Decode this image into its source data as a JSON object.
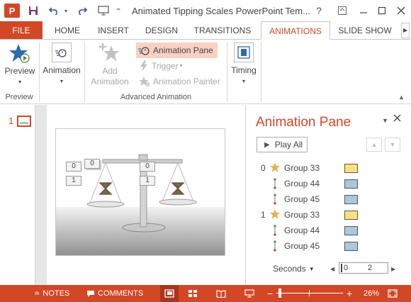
{
  "app": {
    "logo_letter": "P",
    "title": "Animated Tipping Scales PowerPoint Tem...",
    "help_glyph": "?",
    "colors": {
      "accent": "#d24726",
      "highlight": "#f8d1c3"
    }
  },
  "qat": {
    "save_icon": "save-icon",
    "undo_icon": "undo-icon",
    "redo_icon": "redo-icon",
    "present_icon": "start-presentation-icon"
  },
  "tabs": [
    {
      "label": "FILE"
    },
    {
      "label": "HOME"
    },
    {
      "label": "INSERT"
    },
    {
      "label": "DESIGN"
    },
    {
      "label": "TRANSITIONS"
    },
    {
      "label": "ANIMATIONS",
      "active": true
    },
    {
      "label": "SLIDE SHOW"
    }
  ],
  "ribbon": {
    "preview": {
      "label": "Preview",
      "group": "Preview"
    },
    "animation": {
      "label": "Animation"
    },
    "add_animation": {
      "line1": "Add",
      "line2": "Animation"
    },
    "animation_pane": {
      "label": "Animation Pane"
    },
    "trigger": {
      "label": "Trigger"
    },
    "animation_painter": {
      "label": "Animation Painter"
    },
    "advanced_group": "Advanced Animation",
    "timing": {
      "label": "Timing"
    }
  },
  "thumbnails": {
    "slide_number": "1"
  },
  "slide": {
    "counters": [
      "0",
      "0",
      "0",
      "1",
      "1"
    ]
  },
  "pane": {
    "title": "Animation Pane",
    "play_all": "Play All",
    "items": [
      {
        "number": "0",
        "icon": "star-icon",
        "name": "Group 33",
        "bar_color": "#ffe17a"
      },
      {
        "number": "",
        "icon": "motion-path-icon",
        "name": "Group 44",
        "bar_color": "#a9c8dd"
      },
      {
        "number": "",
        "icon": "motion-path-icon",
        "name": "Group 45",
        "bar_color": "#a9c8dd"
      },
      {
        "number": "1",
        "icon": "star-icon",
        "name": "Group 33",
        "bar_color": "#ffe17a"
      },
      {
        "number": "",
        "icon": "motion-path-icon",
        "name": "Group 44",
        "bar_color": "#a9c8dd"
      },
      {
        "number": "",
        "icon": "motion-path-icon",
        "name": "Group 45",
        "bar_color": "#a9c8dd"
      }
    ],
    "seconds_label": "Seconds",
    "timeline_start": "0",
    "timeline_mark": "2"
  },
  "statusbar": {
    "notes": "NOTES",
    "comments": "COMMENTS",
    "zoom": "26%"
  }
}
